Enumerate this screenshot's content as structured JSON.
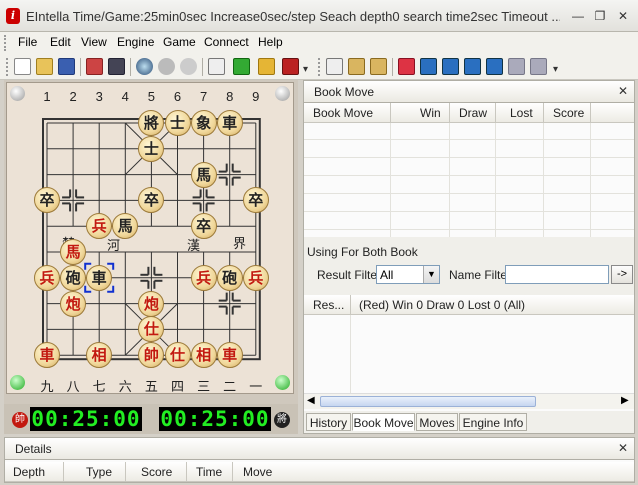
{
  "window": {
    "title": "EIntella Time/Game:25min0sec Increase0sec/step Seach depth0 search time2sec Timeout ...",
    "controls": [
      "—",
      "❐",
      "✕"
    ]
  },
  "menu": [
    "File",
    "Edit",
    "View",
    "Engine",
    "Game",
    "Connect",
    "Help"
  ],
  "toolbar": {
    "left_icons": [
      "new-icon",
      "open-icon",
      "save-icon",
      "print-icon",
      "monitor-icon",
      "search-icon",
      "stop-icon",
      "refresh-icon",
      "notes-icon",
      "move-icon",
      "lock-icon",
      "flag-icon"
    ],
    "right_icons": [
      "copy-icon",
      "paste-icon",
      "paste-special-icon",
      "undo-icon",
      "first-icon",
      "rewind-icon",
      "prev-icon",
      "next-icon",
      "forward-icon",
      "last-icon"
    ]
  },
  "board": {
    "top_numbers": [
      "1",
      "2",
      "3",
      "4",
      "5",
      "6",
      "7",
      "8",
      "9"
    ],
    "bottom_numbers": [
      "九",
      "八",
      "七",
      "六",
      "五",
      "四",
      "三",
      "二",
      "一"
    ],
    "river_left": [
      "楚",
      "河"
    ],
    "river_right": [
      "漢",
      "界"
    ],
    "pieces": [
      {
        "text": "將",
        "side": "black",
        "col": 4,
        "row": 0
      },
      {
        "text": "士",
        "side": "black",
        "col": 5,
        "row": 0
      },
      {
        "text": "象",
        "side": "black",
        "col": 6,
        "row": 0
      },
      {
        "text": "車",
        "side": "black",
        "col": 7,
        "row": 0
      },
      {
        "text": "士",
        "side": "black",
        "col": 4,
        "row": 1
      },
      {
        "text": "馬",
        "side": "black",
        "col": 6,
        "row": 2
      },
      {
        "text": "卒",
        "side": "black",
        "col": 0,
        "row": 3
      },
      {
        "text": "卒",
        "side": "black",
        "col": 4,
        "row": 3
      },
      {
        "text": "卒",
        "side": "black",
        "col": 8,
        "row": 3
      },
      {
        "text": "兵",
        "side": "red",
        "col": 2,
        "row": 4
      },
      {
        "text": "馬",
        "side": "black",
        "col": 3,
        "row": 4
      },
      {
        "text": "卒",
        "side": "black",
        "col": 6,
        "row": 4
      },
      {
        "text": "馬",
        "side": "red",
        "col": 1,
        "row": 5
      },
      {
        "text": "兵",
        "side": "red",
        "col": 0,
        "row": 6
      },
      {
        "text": "砲",
        "side": "black",
        "col": 1,
        "row": 6
      },
      {
        "text": "車",
        "side": "black",
        "col": 2,
        "row": 6
      },
      {
        "text": "兵",
        "side": "red",
        "col": 6,
        "row": 6
      },
      {
        "text": "砲",
        "side": "black",
        "col": 7,
        "row": 6
      },
      {
        "text": "兵",
        "side": "red",
        "col": 8,
        "row": 6
      },
      {
        "text": "炮",
        "side": "red",
        "col": 1,
        "row": 7
      },
      {
        "text": "炮",
        "side": "red",
        "col": 4,
        "row": 7
      },
      {
        "text": "仕",
        "side": "red",
        "col": 4,
        "row": 8
      },
      {
        "text": "車",
        "side": "red",
        "col": 0,
        "row": 9
      },
      {
        "text": "相",
        "side": "red",
        "col": 2,
        "row": 9
      },
      {
        "text": "帥",
        "side": "red",
        "col": 4,
        "row": 9
      },
      {
        "text": "仕",
        "side": "red",
        "col": 5,
        "row": 9
      },
      {
        "text": "相",
        "side": "red",
        "col": 6,
        "row": 9
      },
      {
        "text": "車",
        "side": "red",
        "col": 7,
        "row": 9
      }
    ],
    "selected": {
      "col": 2,
      "row": 6
    },
    "crosses": [
      {
        "col": 1,
        "row": 3
      },
      {
        "col": 2,
        "row": 4
      },
      {
        "col": 6,
        "row": 3
      },
      {
        "col": 7,
        "row": 2
      },
      {
        "col": 4,
        "row": 6
      },
      {
        "col": 7,
        "row": 7
      }
    ]
  },
  "clocks": {
    "red_badge": "帥",
    "red_time": "00:25:00",
    "black_time": "00:25:00",
    "black_badge": "將"
  },
  "book_move": {
    "title": "Book Move",
    "columns": [
      "Book Move",
      "Win",
      "Draw",
      "Lost",
      "Score"
    ],
    "using_label": "Using For Both Book",
    "result_filter_label": "Result Filter",
    "result_filter_value": "All",
    "name_filter_label": "Name Filter",
    "name_filter_value": "",
    "go_button": "->",
    "results_columns": [
      "Res...",
      "(Red) Win 0 Draw 0 Lost 0 (All)"
    ],
    "tabs": [
      "History",
      "Book Move",
      "Moves",
      "Engine Info"
    ],
    "active_tab": "Book Move"
  },
  "details": {
    "title": "Details",
    "columns": [
      "Depth",
      "Type",
      "Score",
      "Time",
      "Move"
    ]
  },
  "colors": {
    "red_piece": "#c21910",
    "black_piece": "#222222",
    "clock_text": "#22ee22",
    "selection": "#1030d0"
  }
}
